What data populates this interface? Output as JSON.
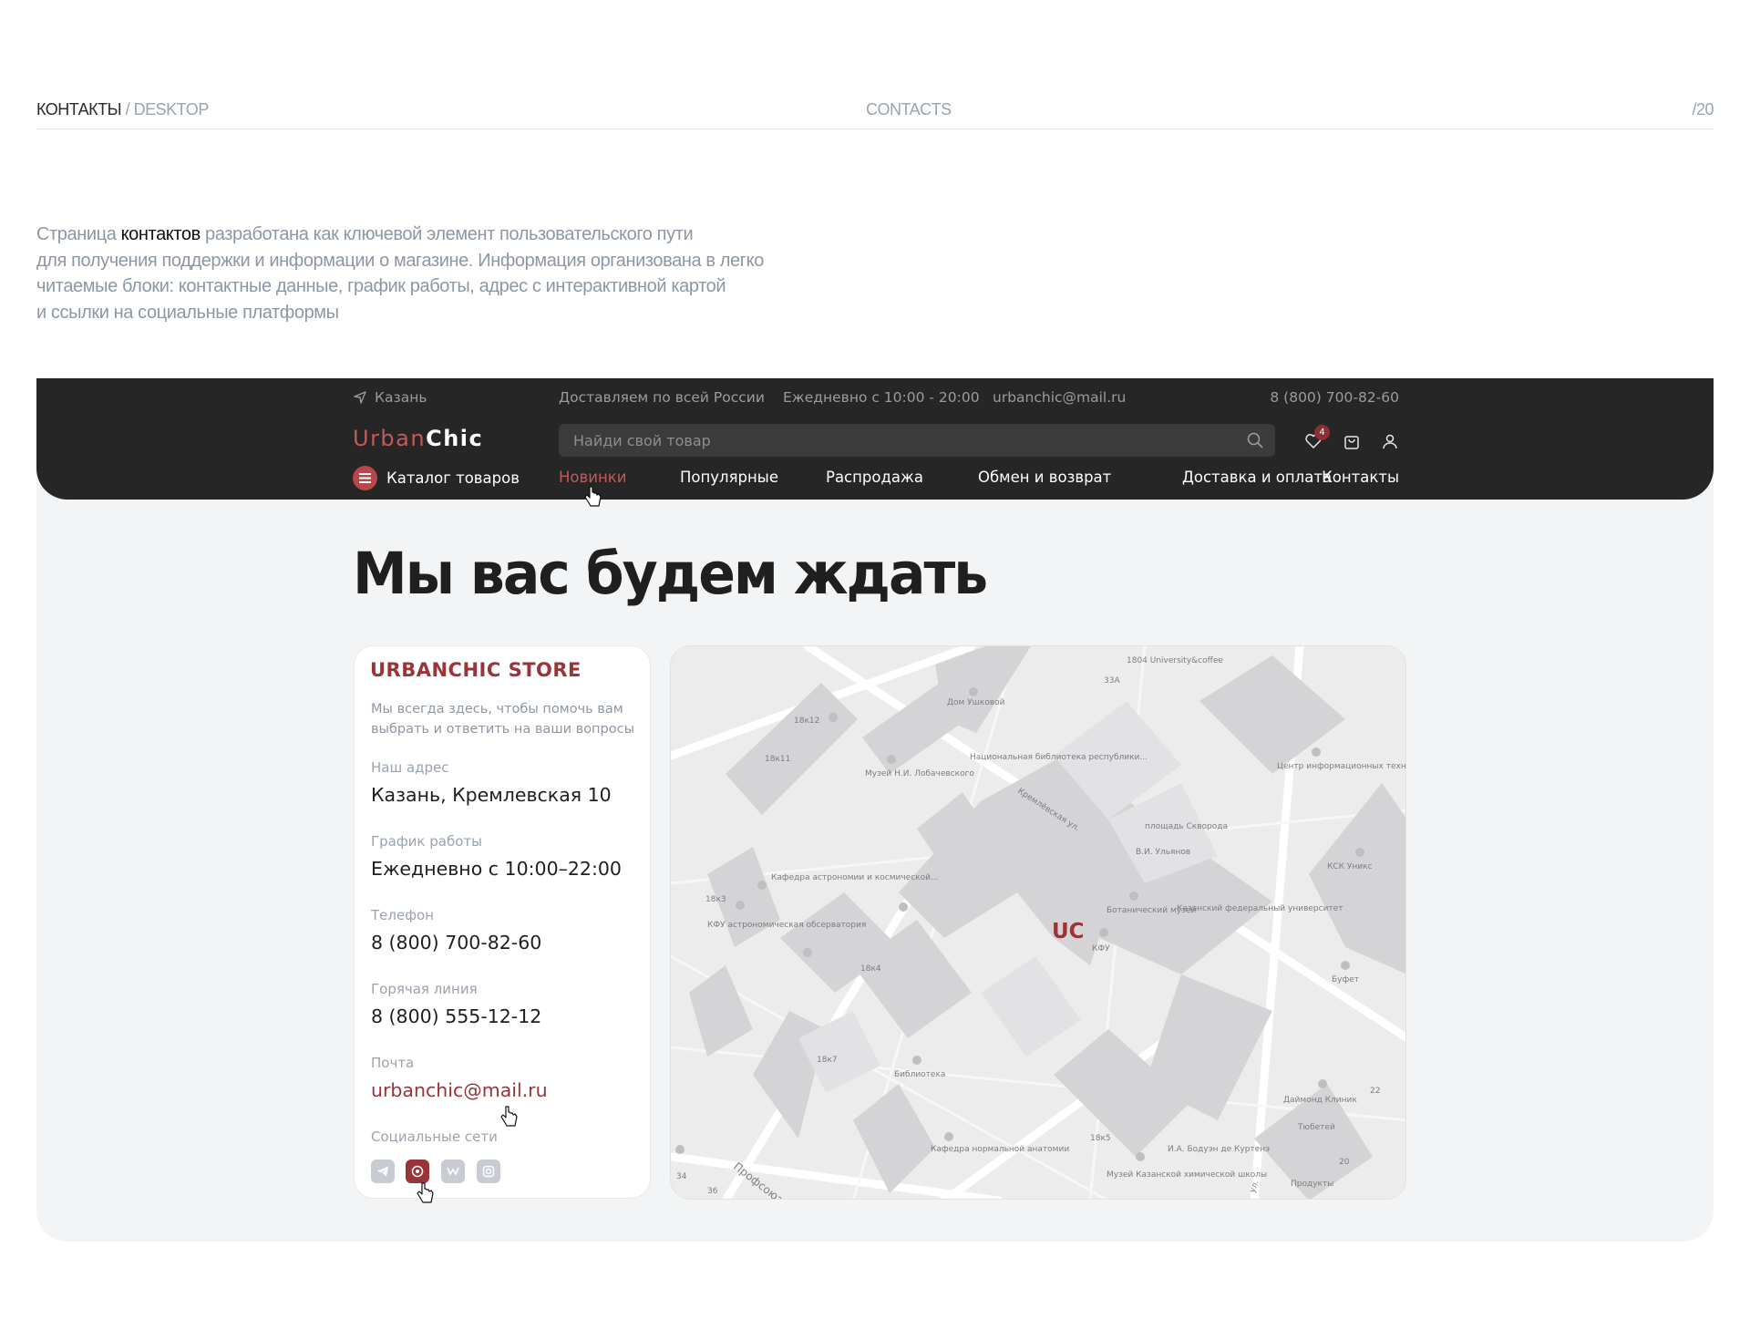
{
  "meta": {
    "left_main": "КОНТАКТЫ",
    "left_sep": " / ",
    "left_muted": "DESKTOP",
    "center": "CONTACTS",
    "right": "/20"
  },
  "intro": {
    "line1_pre": "Страница ",
    "line1_hl": "контактов",
    "line1_post": " разработана как ключевой элемент пользовательского пути",
    "line2": "для получения поддержки и информации о магазине. Информация организована в легко",
    "line3": "читаемые блоки: контактные данные, график работы, адрес с интерактивной картой",
    "line4": "и ссылки на социальные платформы"
  },
  "topbar": {
    "city": "Казань",
    "delivery": "Доставляем по всей России",
    "hours": "Ежедневно с 10:00 - 20:00",
    "email": "urbanchic@mail.ru",
    "phone": "8 (800) 700-82-60"
  },
  "logo": {
    "part1": "Urban",
    "part2": "Chic"
  },
  "search": {
    "placeholder": "Найди свой товар"
  },
  "header_icons": {
    "favorites_count": "4",
    "icons": [
      "heart-icon",
      "bag-icon",
      "user-icon"
    ]
  },
  "nav": {
    "catalog": "Каталог товаров",
    "items": [
      "Новинки",
      "Популярные",
      "Распродажа",
      "Обмен и возврат",
      "Доставка и оплата",
      "Контакты"
    ],
    "active": "Новинки"
  },
  "page_title": "Мы вас будем ждать",
  "card": {
    "store": "URBANCHIC STORE",
    "lead": "Мы всегда здесь, чтобы помочь вам выбрать и ответить на ваши вопросы",
    "address_label": "Наш адрес",
    "address": "Казань, Кремлевская 10",
    "hours_label": "График работы",
    "hours": "Ежедневно с 10:00–22:00",
    "phone_label": "Телефон",
    "phone": "8 (800) 700-82-60",
    "hotline_label": "Горячая линия",
    "hotline": "8 (800) 555-12-12",
    "mail_label": "Почта",
    "mail": "urbanchic@mail.ru",
    "social_label": "Социальные сети",
    "socials": [
      "telegram-icon",
      "whatsapp-icon",
      "vk-icon",
      "instagram-icon"
    ],
    "social_active": "whatsapp-icon"
  },
  "colors": {
    "accent": "#9a3438",
    "accent_light": "#c25a58",
    "header_bg": "#262626",
    "frame_bg": "#f3f4f5",
    "muted": "#8d97a3"
  },
  "map": {
    "marker": "UC",
    "labels": [
      "1804 University&coffee",
      "33А",
      "Дом Ушковой",
      "18к12",
      "18к11",
      "Музей Н.И. Лобачевского",
      "Национальная библиотека республики...",
      "Кремлёвская ул.",
      "площадь Скворода",
      "В.И. Ульянов",
      "Центр информационных технологий",
      "КСК Уникс",
      "Кафедра астрономии и космической...",
      "18к3",
      "КФУ астрономическая обсерватория",
      "Ботанический музей",
      "Казанский федеральный университет",
      "КФУ",
      "18к4",
      "Буфет",
      "18к7",
      "Библиотека",
      "Кафедра нормальной анатомии",
      "18к5",
      "Музей Казанской химической школы",
      "И.А. Бодуэн де Куртенэ",
      "Даймонд Клиник",
      "Тюбетей",
      "Продукты",
      "Профсоюзная",
      "34",
      "36",
      "22",
      "20",
      "ул."
    ]
  }
}
